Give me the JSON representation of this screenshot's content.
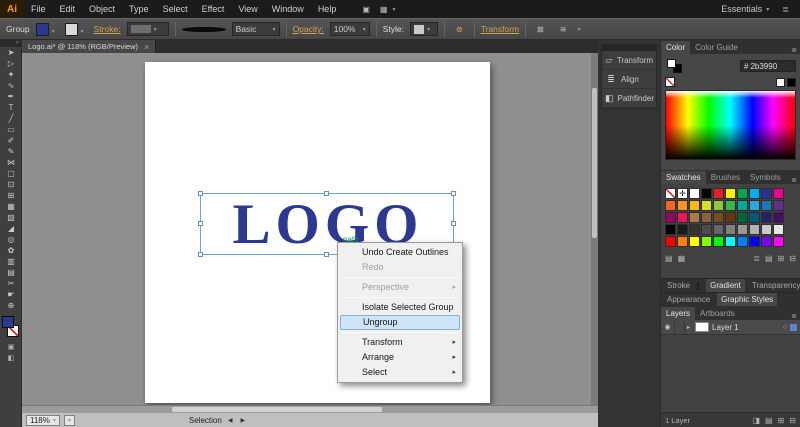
{
  "icons": {
    "caret_down": "▾",
    "submenu_arrow": "▸",
    "close": "×",
    "panel_menu": "≣",
    "prev_arrow": "◀",
    "next_arrow": "▶",
    "eye": "◉",
    "target_circle": "○",
    "expand_triangle": "▸",
    "bridge": "▣",
    "arrange_documents": "▦",
    "toolbar_collapse": "»",
    "registration": "✛",
    "recolor_artwork": "⊛",
    "select_similar": "⊠",
    "align_options": "≋",
    "swatch_libraries": "▤",
    "swatch_kinds": "▦",
    "swatch_options": "≣",
    "new_swatch": "⊞",
    "delete_swatch": "⊟",
    "clipping_mask": "◨",
    "new_sublayer": "▤",
    "new_layer": "⊞",
    "delete_layer": "⊟",
    "draw_modes": "▣",
    "screen_mode": "◧"
  },
  "menu_bar": {
    "app_logo": "Ai",
    "items": [
      "File",
      "Edit",
      "Object",
      "Type",
      "Select",
      "Effect",
      "View",
      "Window",
      "Help"
    ],
    "workspace_label": "Essentials"
  },
  "control_bar": {
    "context_label": "Group",
    "stroke_label": "Stroke:",
    "brush_name": "Basic",
    "opacity_label": "Opacity:",
    "opacity_value": "100%",
    "style_label": "Style:",
    "transform_label": "Transform"
  },
  "document": {
    "tab_title": "Logo.ai* @ 118% (RGB/Preview)",
    "artwork_text": "LOGO",
    "artwork_color": "#2b3990",
    "smart_guide_label": "path"
  },
  "toolbar": {
    "tools": [
      {
        "name": "selection-tool",
        "glyph": "➤"
      },
      {
        "name": "direct-selection-tool",
        "glyph": "▷"
      },
      {
        "name": "magic-wand-tool",
        "glyph": "✦"
      },
      {
        "name": "lasso-tool",
        "glyph": "∿"
      },
      {
        "name": "pen-tool",
        "glyph": "✒"
      },
      {
        "name": "type-tool",
        "glyph": "T"
      },
      {
        "name": "line-segment-tool",
        "glyph": "╱"
      },
      {
        "name": "rectangle-tool",
        "glyph": "▭"
      },
      {
        "name": "paintbrush-tool",
        "glyph": "✐"
      },
      {
        "name": "pencil-tool",
        "glyph": "✎"
      },
      {
        "name": "width-tool",
        "glyph": "⋈"
      },
      {
        "name": "free-transform-tool",
        "glyph": "▢"
      },
      {
        "name": "shape-builder-tool",
        "glyph": "⊡"
      },
      {
        "name": "perspective-grid-tool",
        "glyph": "⊞"
      },
      {
        "name": "mesh-tool",
        "glyph": "▦"
      },
      {
        "name": "gradient-tool",
        "glyph": "▧"
      },
      {
        "name": "eyedropper-tool",
        "glyph": "◢"
      },
      {
        "name": "blend-tool",
        "glyph": "◎"
      },
      {
        "name": "symbol-sprayer-tool",
        "glyph": "✿"
      },
      {
        "name": "column-graph-tool",
        "glyph": "▥"
      },
      {
        "name": "artboard-tool",
        "glyph": "▤"
      },
      {
        "name": "slice-tool",
        "glyph": "✂"
      },
      {
        "name": "hand-tool",
        "glyph": "☛"
      },
      {
        "name": "zoom-tool",
        "glyph": "⊕"
      }
    ]
  },
  "icon_dock": {
    "panels": [
      {
        "name": "transform-panel-button",
        "label": "Transform",
        "glyph": "▱"
      },
      {
        "name": "align-panel-button",
        "label": "Align",
        "glyph": "≣"
      },
      {
        "name": "pathfinder-panel-button",
        "label": "Pathfinder",
        "glyph": "◧"
      }
    ]
  },
  "context_menu": {
    "items": [
      {
        "label": "Undo Create Outlines",
        "state": "normal"
      },
      {
        "label": "Redo",
        "state": "disabled"
      },
      {
        "label": "Perspective",
        "state": "disabled",
        "submenu": true
      },
      {
        "label": "Isolate Selected Group",
        "state": "normal"
      },
      {
        "label": "Ungroup",
        "state": "highlighted"
      },
      {
        "label": "Transform",
        "state": "normal",
        "submenu": true
      },
      {
        "label": "Arrange",
        "state": "normal",
        "submenu": true
      },
      {
        "label": "Select",
        "state": "normal",
        "submenu": true
      }
    ]
  },
  "panels": {
    "color": {
      "tabs": [
        "Color",
        "Color Guide"
      ],
      "active_tab": "Color",
      "hex_prefix": "#",
      "hex_value": "2b3990"
    },
    "swatches": {
      "tabs": [
        "Swatches",
        "Brushes",
        "Symbols"
      ],
      "active_tab": "Swatches",
      "grid": [
        [
          "none",
          "reg",
          "#ffffff",
          "#000000",
          "#ed1c24",
          "#fff200",
          "#00a651",
          "#00aeef",
          "#2e3192",
          "#ec008c"
        ],
        [
          "#f26522",
          "#f7941d",
          "#fdb913",
          "#d7df23",
          "#8dc63f",
          "#39b54a",
          "#00a99d",
          "#27aae1",
          "#1b75bb",
          "#662d91"
        ],
        [
          "#9e005d",
          "#ed145b",
          "#a97c50",
          "#8c6239",
          "#754c24",
          "#603913",
          "#006838",
          "#005b7f",
          "#262262",
          "#440e62"
        ],
        [
          "#000000",
          "#1a1a1a",
          "#333333",
          "#4d4d4d",
          "#666666",
          "#808080",
          "#999999",
          "#b3b3b3",
          "#cccccc",
          "#e6e6e6"
        ],
        [
          "#ff0000",
          "#ff7f00",
          "#ffff00",
          "#80ff00",
          "#00ff00",
          "#00ffff",
          "#0080ff",
          "#0000ff",
          "#8000ff",
          "#ff00ff"
        ]
      ]
    },
    "collapsed_tabs_1": [
      "Stroke",
      "Gradient",
      "Transparency"
    ],
    "collapsed_tabs_2": [
      "Appearance",
      "Graphic Styles"
    ],
    "layers": {
      "tabs": [
        "Layers",
        "Artboards"
      ],
      "active_tab": "Layers",
      "layer_name": "Layer 1",
      "count_label": "1 Layer"
    }
  },
  "status_bar": {
    "zoom_value": "118%",
    "tool_label": "Selection"
  }
}
